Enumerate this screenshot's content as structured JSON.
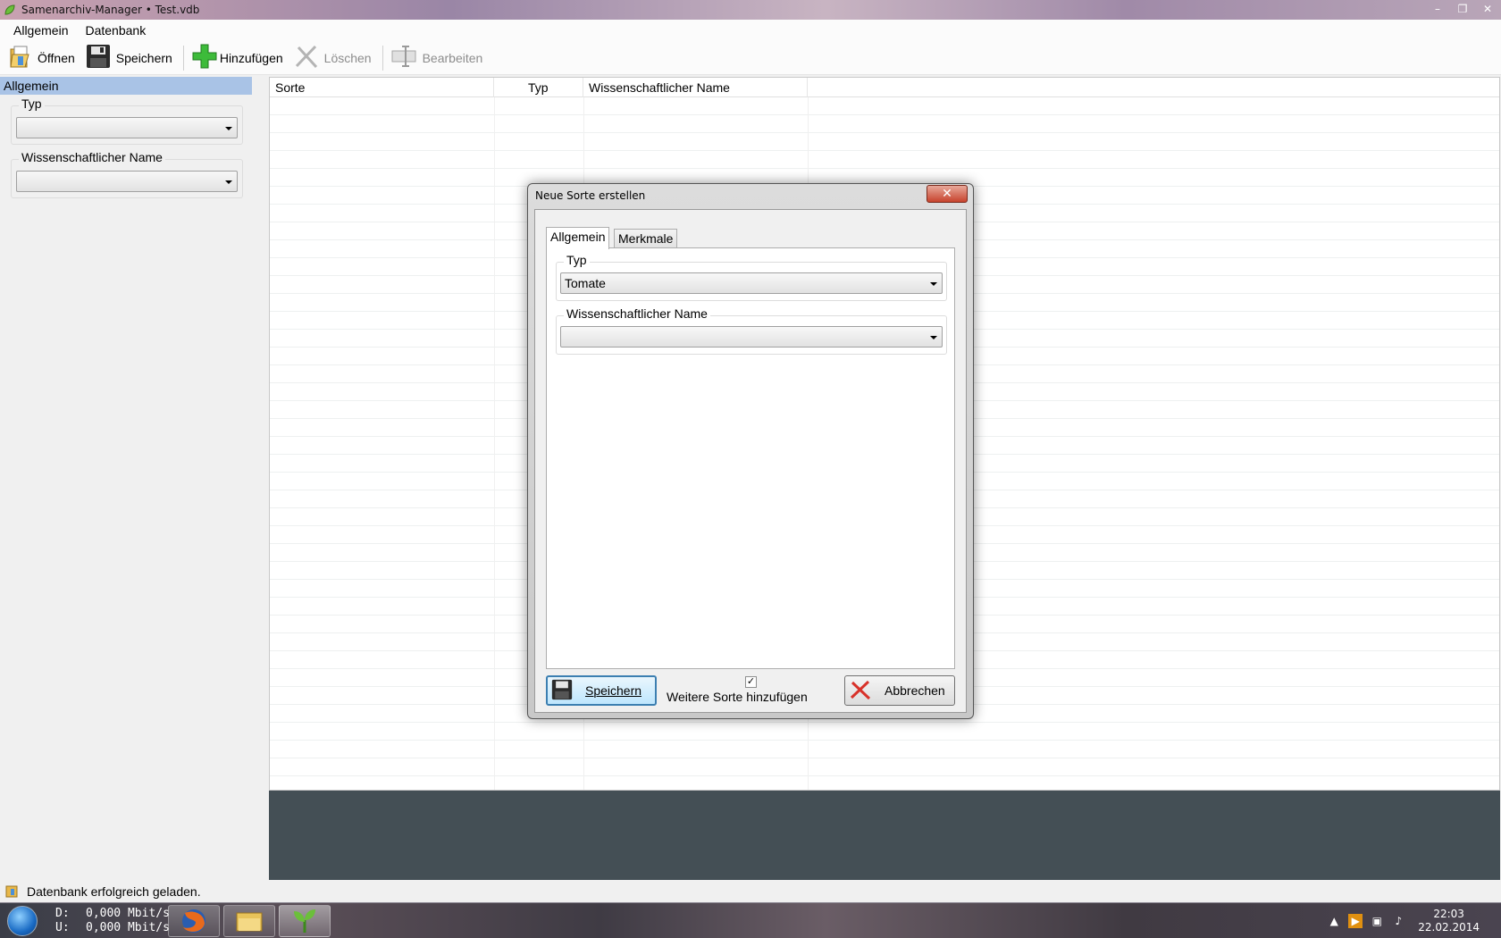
{
  "window": {
    "title": "Samenarchiv-Manager • Test.vdb"
  },
  "menu": {
    "items": [
      "Allgemein",
      "Datenbank"
    ]
  },
  "toolbar": {
    "open": "Öffnen",
    "save": "Speichern",
    "add": "Hinzufügen",
    "delete": "Löschen",
    "edit": "Bearbeiten"
  },
  "filter_panel": {
    "header": "Allgemein",
    "typ_label": "Typ",
    "typ_value": "",
    "sci_label": "Wissenschaftlicher Name",
    "sci_value": ""
  },
  "grid": {
    "columns": [
      "Sorte",
      "Typ",
      "Wissenschaftlicher Name"
    ],
    "rows": []
  },
  "status": {
    "message": "Datenbank erfolgreich geladen."
  },
  "dialog": {
    "title": "Neue Sorte erstellen",
    "tabs": [
      "Allgemein",
      "Merkmale"
    ],
    "typ_label": "Typ",
    "typ_value": "Tomate",
    "sci_label": "Wissenschaftlicher Name",
    "sci_value": "",
    "save_label": "Speichern",
    "checkbox_label": "Weitere Sorte hinzufügen",
    "checkbox_checked": true,
    "cancel_label": "Abbrechen"
  },
  "taskbar": {
    "net_down_key": "D:",
    "net_down": "0,000 Mbit/s",
    "net_up_key": "U:",
    "net_up": "0,000 Mbit/s",
    "time": "22:03",
    "date": "22.02.2014"
  }
}
